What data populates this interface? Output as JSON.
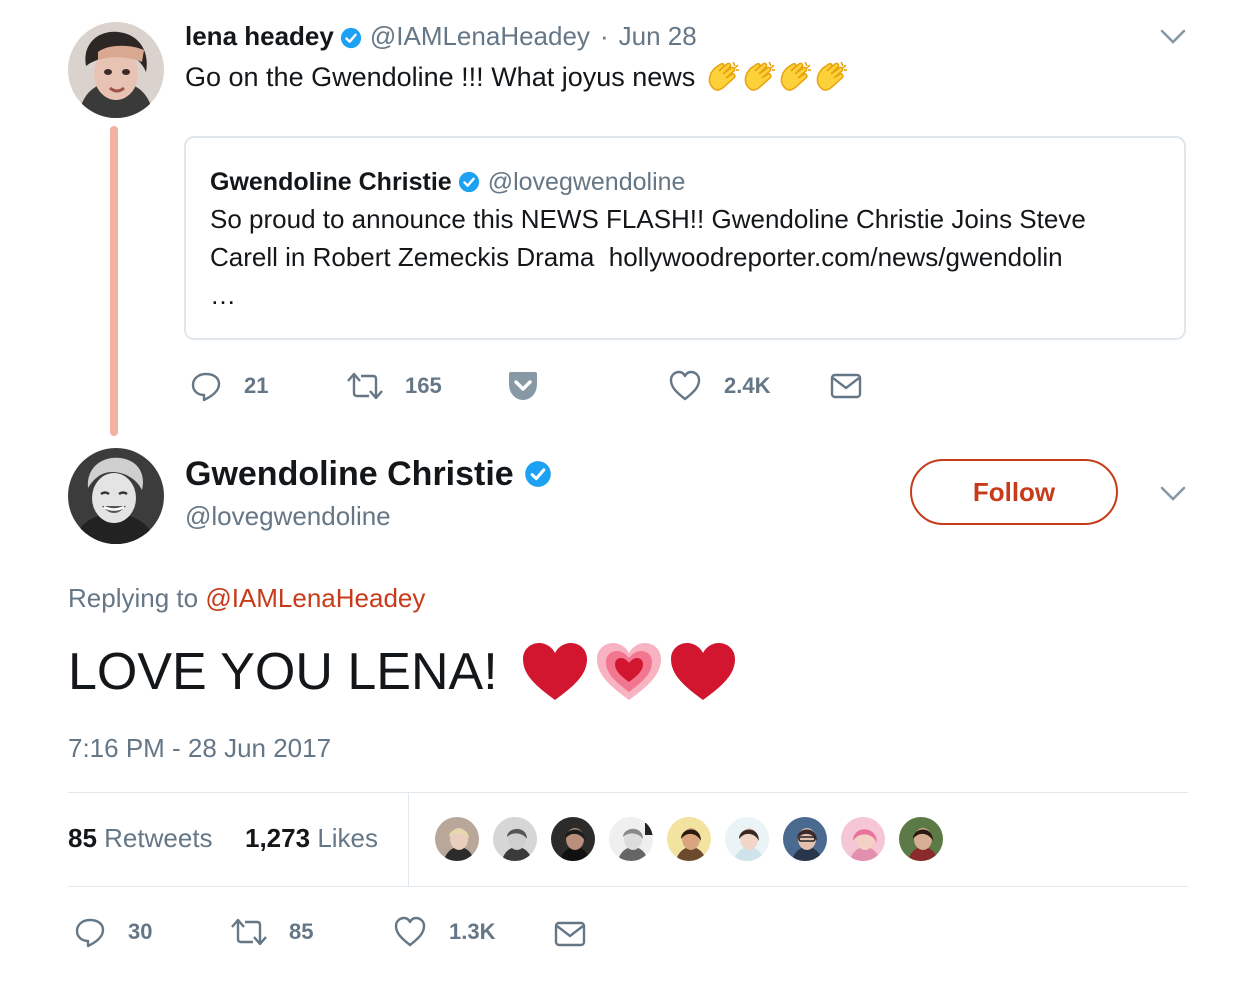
{
  "quoting_tweet": {
    "author_name": "lena headey",
    "author_handle": "@IAMLenaHeadey",
    "separator": "·",
    "date": "Jun 28",
    "text": "Go on the Gwendoline !!! What joyus news",
    "emojis": [
      "clapping-hands",
      "clapping-hands",
      "clapping-hands",
      "clapping-hands"
    ],
    "quoted": {
      "author_name": "Gwendoline Christie",
      "author_handle": "@lovegwendoline",
      "line1": "So proud to announce this NEWS FLASH!! Gwendoline Christie Joins Steve",
      "line2": "Carell in Robert Zemeckis Drama  hollywoodreporter.com/news/gwendolin",
      "line3": "…"
    },
    "actions": {
      "replies": "21",
      "retweets": "165",
      "likes": "2.4K"
    }
  },
  "main_tweet": {
    "author_name": "Gwendoline Christie",
    "author_handle": "@lovegwendoline",
    "follow_label": "Follow",
    "replying_prefix": "Replying to",
    "replying_handle": "@IAMLenaHeadey",
    "text": "LOVE YOU LENA!",
    "emojis": [
      "red-heart",
      "growing-heart",
      "red-heart"
    ],
    "timestamp": "7:16 PM - 28 Jun 2017",
    "stats": {
      "retweets_count": "85",
      "retweets_label": "Retweets",
      "likes_count": "1,273",
      "likes_label": "Likes"
    },
    "likers_count": 9,
    "actions": {
      "replies": "30",
      "retweets": "85",
      "likes": "1.3K"
    }
  },
  "colors": {
    "accent": "#c73b1a",
    "muted": "#657786",
    "verified": "#1da1f2",
    "thread_line": "#f1b1a3",
    "border": "#e1e8ed"
  }
}
